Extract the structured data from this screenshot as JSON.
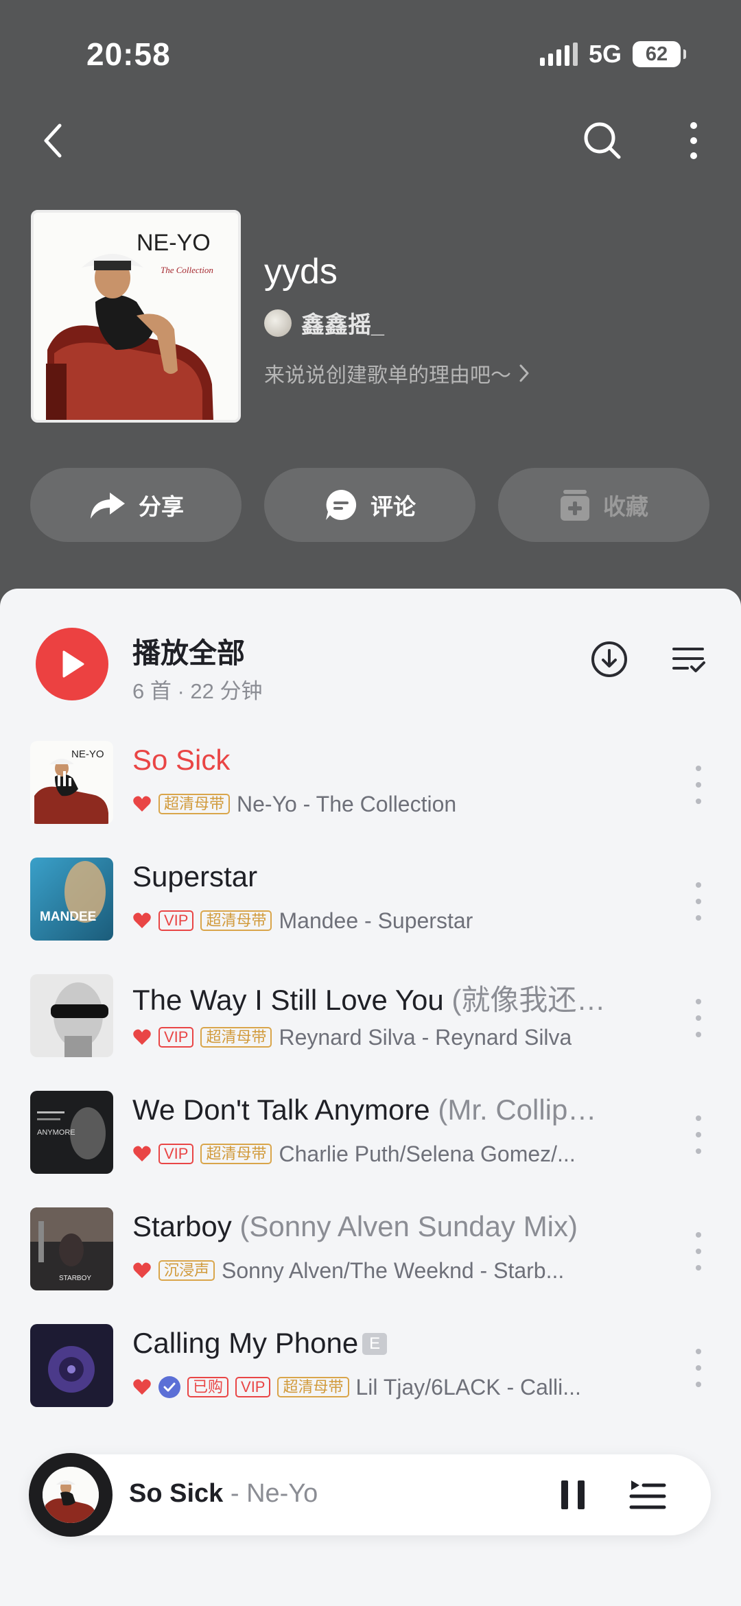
{
  "status_bar": {
    "time": "20:58",
    "network": "5G",
    "battery": "62"
  },
  "nav": {
    "back_icon": "chevron-left-icon",
    "search_icon": "search-icon",
    "more_icon": "more-vertical-icon"
  },
  "playlist": {
    "cover_artist_text": "NE-YO",
    "cover_subtitle_text": "The Collection",
    "title": "yyds",
    "owner": "鑫鑫摇_",
    "description": "来说说创建歌单的理由吧～"
  },
  "actions": {
    "share": "分享",
    "comment": "评论",
    "collect": "收藏"
  },
  "play_all": {
    "label": "播放全部",
    "meta": "6 首 · 22 分钟"
  },
  "songs": [
    {
      "title": "So Sick",
      "title_suffix": "",
      "tags": [
        "超清母带"
      ],
      "artist": "Ne-Yo - The Collection",
      "cover_text": "NE-YO"
    },
    {
      "title": "Superstar",
      "title_suffix": "",
      "tags": [
        "VIP",
        "超清母带"
      ],
      "artist": "Mandee - Superstar",
      "cover_text": "MANDEE"
    },
    {
      "title": "The Way I Still Love You",
      "title_suffix": "(就像我还…",
      "tags": [
        "VIP",
        "超清母带"
      ],
      "artist": "Reynard Silva - Reynard Silva"
    },
    {
      "title": "We Don't Talk Anymore",
      "title_suffix": "(Mr. Collip…",
      "tags": [
        "VIP",
        "超清母带"
      ],
      "artist": "Charlie Puth/Selena Gomez/...",
      "cover_text": "ANYMORE"
    },
    {
      "title": "Starboy",
      "title_suffix": "(Sonny Alven Sunday Mix)",
      "tags": [
        "沉浸声"
      ],
      "artist": "Sonny Alven/The Weeknd - Starb...",
      "cover_text": "STARBOY"
    },
    {
      "title": "Calling My Phone",
      "title_suffix": "",
      "explicit": "E",
      "tags": [
        "已购",
        "VIP",
        "超清母带"
      ],
      "artist": "Lil Tjay/6LACK - Calli..."
    }
  ],
  "mini_player": {
    "song": "So Sick",
    "separator": " - ",
    "artist": "Ne-Yo"
  },
  "colors": {
    "header_bg": "#555657",
    "accent_red": "#ec4141",
    "tag_gold": "#d19a3b",
    "verified_blue": "#5b6fd6"
  }
}
